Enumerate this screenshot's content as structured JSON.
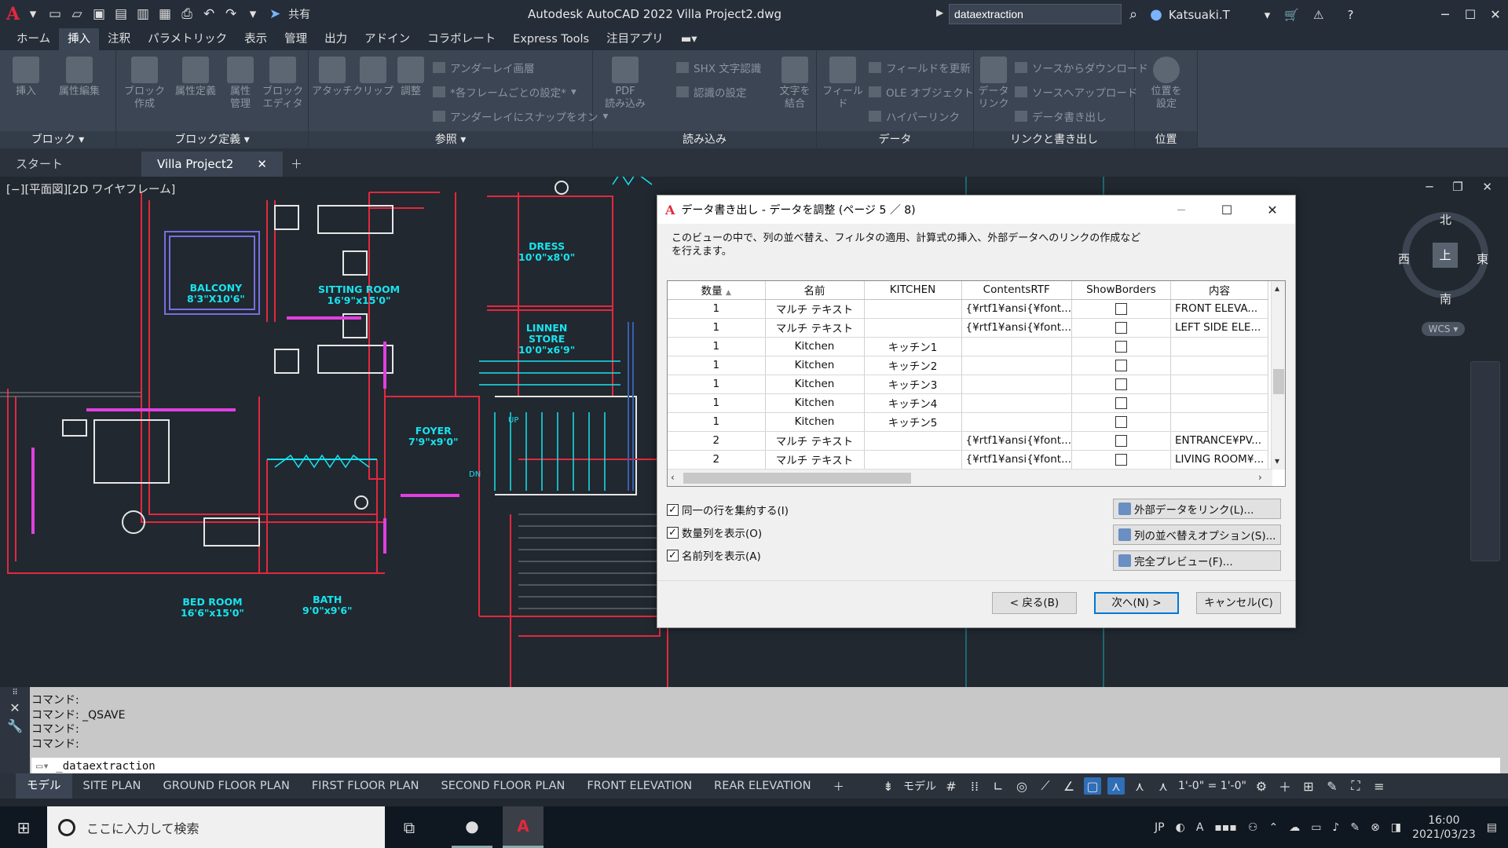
{
  "titlebar": {
    "app_title": "Autodesk AutoCAD 2022   Villa Project2.dwg",
    "share_label": "共有",
    "search_value": "dataextraction",
    "user_name": "Katsuaki.T"
  },
  "menu": {
    "tabs": [
      "ホーム",
      "挿入",
      "注釈",
      "パラメトリック",
      "表示",
      "管理",
      "出力",
      "アドイン",
      "コラボレート",
      "Express Tools",
      "注目アプリ"
    ],
    "active": "挿入"
  },
  "ribbon": {
    "block": {
      "name": "ブロック",
      "insert": "挿入",
      "attr_edit": "属性編集"
    },
    "blockdef": {
      "name": "ブロック定義",
      "create": "ブロック\n作成",
      "attr_def": "属性定義",
      "attr_manage": "属性\n管理",
      "block_editor": "ブロック\nエディタ"
    },
    "reference": {
      "name": "参照",
      "attach": "アタッチ",
      "clip": "クリップ",
      "adjust": "調整",
      "underlay_layer": "アンダーレイ画層",
      "frame_setting": "*各フレームごとの設定*",
      "snap_underlay": "アンダーレイにスナップをオン"
    },
    "import": {
      "name": "読み込み",
      "pdf_import": "PDF\n読み込み",
      "shx": "SHX 文字認識",
      "recog_setting": "認識の設定",
      "text_combine": "文字を\n結合"
    },
    "data": {
      "name": "データ",
      "field": "フィールド",
      "update_field": "フィールドを更新",
      "ole": "OLE オブジェクト",
      "hyperlink": "ハイパーリンク"
    },
    "link": {
      "name": "リンクと書き出し",
      "data_link": "データ\nリンク",
      "download_source": "ソースからダウンロード",
      "upload_source": "ソースへアップロード",
      "extract_data": "データ書き出し"
    },
    "location": {
      "name": "位置",
      "set_location": "位置を\n設定"
    }
  },
  "filetabs": {
    "start": "スタート",
    "active": "Villa Project2"
  },
  "viewport": {
    "label": "[−][平面図][2D ワイヤフレーム]",
    "compass": {
      "n": "北",
      "s": "南",
      "e": "東",
      "w": "西",
      "top": "上"
    },
    "wcs": "WCS",
    "rooms": [
      {
        "name": "BALCONY",
        "size": "8'3\"X10'6\""
      },
      {
        "name": "SITTING ROOM",
        "size": "16'9\"x15'0\""
      },
      {
        "name": "DRESS",
        "size": "10'0\"x8'0\""
      },
      {
        "name": "LINNEN\nSTORE",
        "size": "10'0\"x6'9\""
      },
      {
        "name": "FOYER",
        "size": "7'9\"x9'0\""
      },
      {
        "name": "BED ROOM",
        "size": "16'6\"x15'0\""
      },
      {
        "name": "BATH",
        "size": "9'0\"x9'6\""
      }
    ],
    "up_label": "UP",
    "dn_label": "DN"
  },
  "dialog": {
    "title": "データ書き出し - データを調整 (ページ 5 ／ 8)",
    "description": "このビューの中で、列の並べ替え、フィルタの適用、計算式の挿入、外部データへのリンクの作成などを行えます。",
    "columns": [
      "数量",
      "名前",
      "KITCHEN",
      "ContentsRTF",
      "ShowBorders",
      "内容"
    ],
    "rows": [
      {
        "qty": "1",
        "name": "マルチ テキスト",
        "kitchen": "",
        "rtf": "{¥rtf1¥ansi{¥font...",
        "content": "FRONT ELEVA..."
      },
      {
        "qty": "1",
        "name": "マルチ テキスト",
        "kitchen": "",
        "rtf": "{¥rtf1¥ansi{¥font...",
        "content": "LEFT SIDE ELE..."
      },
      {
        "qty": "1",
        "name": "Kitchen",
        "kitchen": "キッチン1",
        "rtf": "",
        "content": ""
      },
      {
        "qty": "1",
        "name": "Kitchen",
        "kitchen": "キッチン2",
        "rtf": "",
        "content": ""
      },
      {
        "qty": "1",
        "name": "Kitchen",
        "kitchen": "キッチン3",
        "rtf": "",
        "content": ""
      },
      {
        "qty": "1",
        "name": "Kitchen",
        "kitchen": "キッチン4",
        "rtf": "",
        "content": ""
      },
      {
        "qty": "1",
        "name": "Kitchen",
        "kitchen": "キッチン5",
        "rtf": "",
        "content": ""
      },
      {
        "qty": "2",
        "name": "マルチ テキスト",
        "kitchen": "",
        "rtf": "{¥rtf1¥ansi{¥font...",
        "content": "ENTRANCE¥PV..."
      },
      {
        "qty": "2",
        "name": "マルチ テキスト",
        "kitchen": "",
        "rtf": "{¥rtf1¥ansi{¥font...",
        "content": "LIVING ROOM¥..."
      }
    ],
    "options": {
      "combine_rows": "同一の行を集約する(I)",
      "show_count": "数量列を表示(O)",
      "show_name": "名前列を表示(A)"
    },
    "right_buttons": {
      "link_external": "外部データをリンク(L)...",
      "sort_options": "列の並べ替えオプション(S)...",
      "full_preview": "完全プレビュー(F)..."
    },
    "buttons": {
      "back": "< 戻る(B)",
      "next": "次へ(N) >",
      "cancel": "キャンセル(C)"
    }
  },
  "command": {
    "history": [
      "コマンド:",
      "コマンド:  _QSAVE",
      "コマンド:",
      "コマンド:"
    ],
    "input": "_dataextraction"
  },
  "layouts": {
    "tabs": [
      "モデル",
      "SITE PLAN",
      "GROUND FLOOR PLAN",
      "FIRST FLOOR PLAN",
      "SECOND FLOOR PLAN",
      "FRONT  ELEVATION",
      "REAR  ELEVATION"
    ],
    "active": "モデル"
  },
  "statusbar": {
    "model": "モデル",
    "scale": "1'-0\" = 1'-0\""
  },
  "taskbar": {
    "search_placeholder": "ここに入力して検索",
    "ime": "JP",
    "time": "16:00",
    "date": "2021/03/23"
  }
}
